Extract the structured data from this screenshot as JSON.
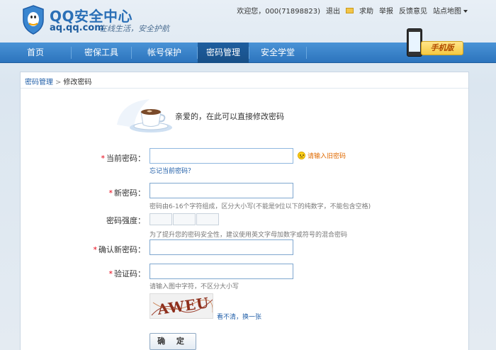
{
  "header": {
    "logo_title": "QQ安全中心",
    "logo_domain": "aq.qq.com",
    "slogan": "在线生活，安全护航",
    "welcome": "欢迎您，000(71898823)",
    "logout": "退出",
    "help": "求助",
    "report": "举报",
    "feedback": "反馈意见",
    "sitemap": "站点地图"
  },
  "nav": {
    "items": [
      {
        "label": "首页"
      },
      {
        "label": "密保工具"
      },
      {
        "label": "帐号保护"
      },
      {
        "label": "密码管理"
      },
      {
        "label": "安全学堂"
      }
    ],
    "active_index": 3,
    "mobile_label": "手机版"
  },
  "breadcrumb": {
    "parent": "密码管理",
    "current": "修改密码"
  },
  "intro_text": "亲爱的，在此可以直接修改密码",
  "form": {
    "current_password": {
      "label": "当前密码：",
      "value": "",
      "warning": "请输入旧密码",
      "forgot_link": "忘记当前密码？"
    },
    "new_password": {
      "label": "新密码：",
      "value": "",
      "hint": "密码由6-16个字符组成，区分大小写(不能是9位以下的纯数字，不能包含空格)"
    },
    "strength": {
      "label": "密码强度：",
      "hint": "为了提升您的密码安全性，建议使用英文字母加数字或符号的混合密码"
    },
    "confirm_password": {
      "label": "确认新密码：",
      "value": ""
    },
    "captcha": {
      "label": "验证码：",
      "value": "",
      "hint": "请输入图中字符，不区分大小写",
      "image_text": "AWEU",
      "refresh_link": "看不清，换一张"
    },
    "submit_label": "确 定"
  },
  "colors": {
    "nav_bg": "#2c74bd",
    "nav_active": "#184f87",
    "link": "#1f5ea8",
    "required": "#e60012",
    "warning": "#e06a00"
  }
}
